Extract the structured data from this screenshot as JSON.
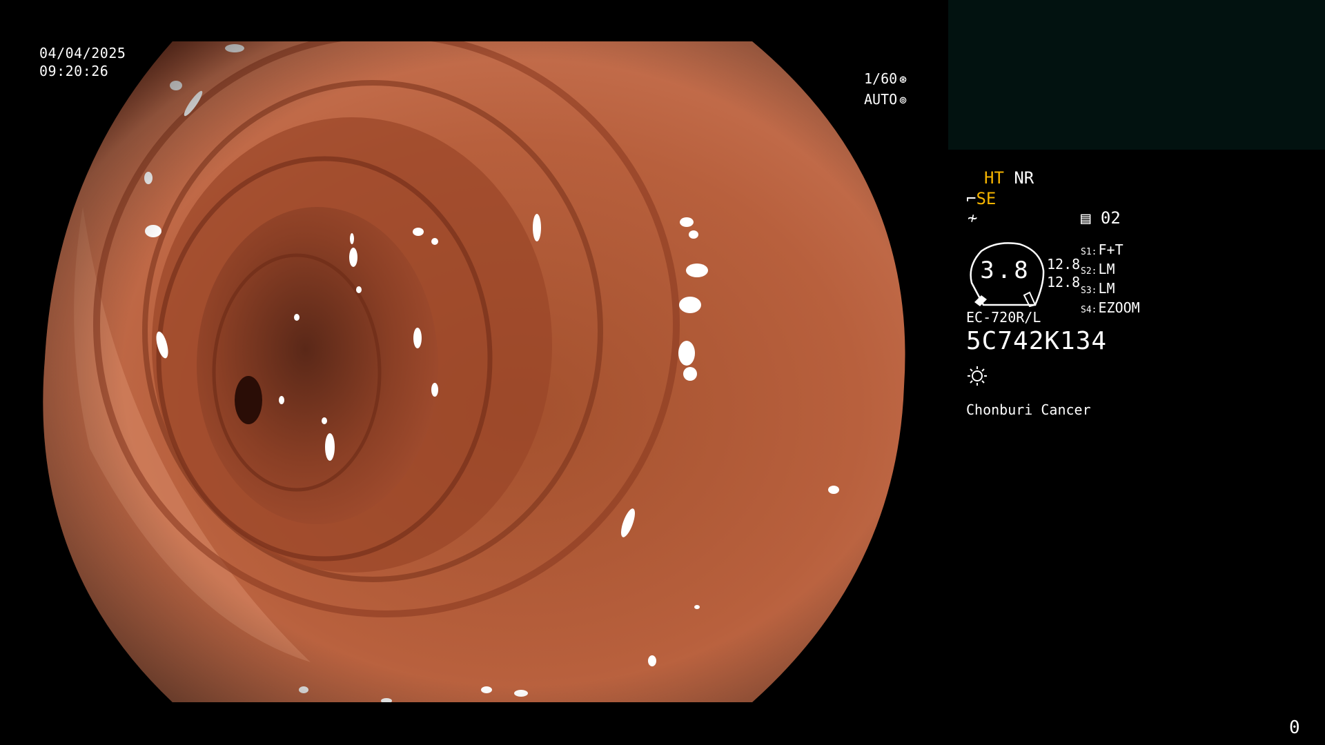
{
  "overlay": {
    "date": "04/04/2025",
    "time": "09:20:26",
    "shutter_speed": "1/60",
    "exposure_mode": "AUTO",
    "shutter_icon": "aperture-icon",
    "auto_icon": "iris-icon"
  },
  "status": {
    "ht_label": "HT",
    "nr_label": "NR",
    "se_label": "SE",
    "se_icon": "scope-tip-icon",
    "enhance_icon": "enhance-icon",
    "preset_icon": "preset-list-icon",
    "preset_value": "02",
    "dial_value": "3.8",
    "num_1": "12.8",
    "num_2": "12.8",
    "slots": [
      {
        "key": "S1:",
        "value": "F+T"
      },
      {
        "key": "S2:",
        "value": "LM"
      },
      {
        "key": "S3:",
        "value": "LM"
      },
      {
        "key": "S4:",
        "value": "EZOOM"
      }
    ],
    "model": "EC-720R/L",
    "serial": "5C742K134",
    "light_icon": "light-source-icon",
    "hospital": "Chonburi Cancer"
  },
  "frame_counter": "0",
  "colors": {
    "accent_yellow": "#f5b400",
    "thumbnail_bg": "#021210",
    "tissue": "#b5583a"
  }
}
